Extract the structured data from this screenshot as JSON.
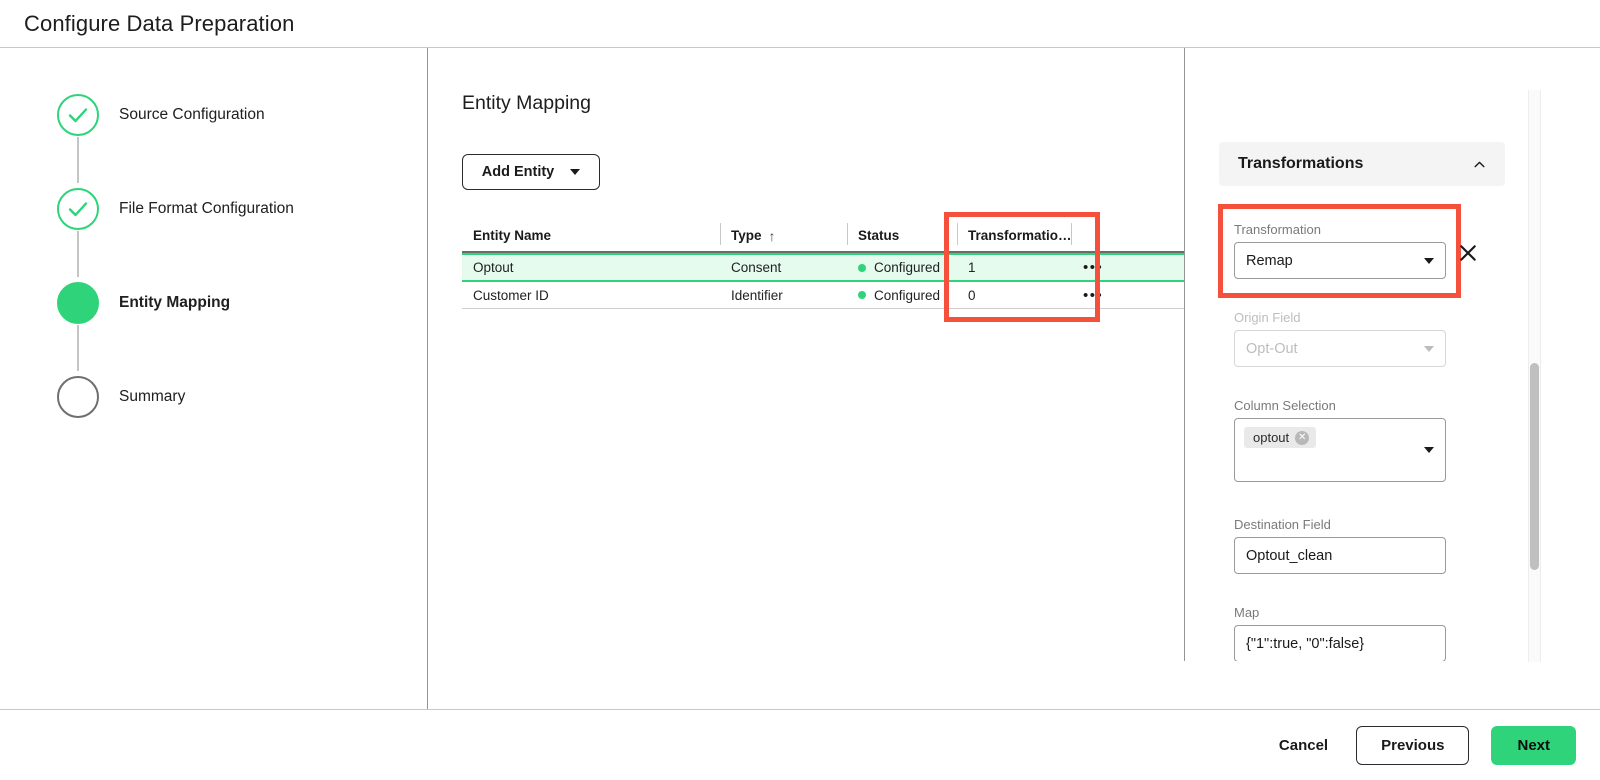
{
  "window": {
    "title": "Configure Data Preparation"
  },
  "colors": {
    "accent_green": "#2fd37a",
    "selected_row_bg": "#e4fbed",
    "annotation_red": "#f4503c",
    "panel_header_bg": "#f4f4f4",
    "muted_text": "#7a7a7a"
  },
  "sidebar": {
    "steps": [
      {
        "label": "Source Configuration",
        "state": "done",
        "icon": "check-icon"
      },
      {
        "label": "File Format Configuration",
        "state": "done",
        "icon": "check-icon"
      },
      {
        "label": "Entity Mapping",
        "state": "current",
        "icon": "filled-dot-icon"
      },
      {
        "label": "Summary",
        "state": "todo",
        "icon": "empty-circle-icon"
      }
    ]
  },
  "main": {
    "section_title": "Entity Mapping",
    "add_entity_label": "Add Entity",
    "add_entity_caret": "chevron-down-icon",
    "table": {
      "columns": [
        {
          "label": "Entity Name",
          "sort": ""
        },
        {
          "label": "Type",
          "sort": "ascending-arrow-icon"
        },
        {
          "label": "Status",
          "sort": ""
        },
        {
          "label": "Transformatio…",
          "sort": ""
        },
        {
          "label": "",
          "sort": ""
        }
      ],
      "rows": [
        {
          "entity_name": "Optout",
          "type": "Consent",
          "status": "Configured",
          "transformations": "1",
          "menu": "•••",
          "selected": true
        },
        {
          "entity_name": "Customer ID",
          "type": "Identifier",
          "status": "Configured",
          "transformations": "0",
          "menu": "•••",
          "selected": false
        }
      ]
    }
  },
  "right_panel": {
    "header_title": "Transformations",
    "header_toggle_icon": "chevron-up-icon",
    "close_icon": "close-icon",
    "fields": {
      "transformation": {
        "label": "Transformation",
        "value": "Remap",
        "disabled": false
      },
      "origin_field": {
        "label": "Origin Field",
        "value": "Opt-Out",
        "disabled": true
      },
      "column_selection": {
        "label": "Column Selection",
        "chips": [
          "optout"
        ],
        "chip_remove_icon": "chip-close-icon"
      },
      "destination_field": {
        "label": "Destination Field",
        "value": "Optout_clean"
      },
      "map": {
        "label": "Map",
        "value": "{\"1\":true, \"0\":false}"
      }
    }
  },
  "footer": {
    "cancel_label": "Cancel",
    "previous_label": "Previous",
    "next_label": "Next"
  }
}
